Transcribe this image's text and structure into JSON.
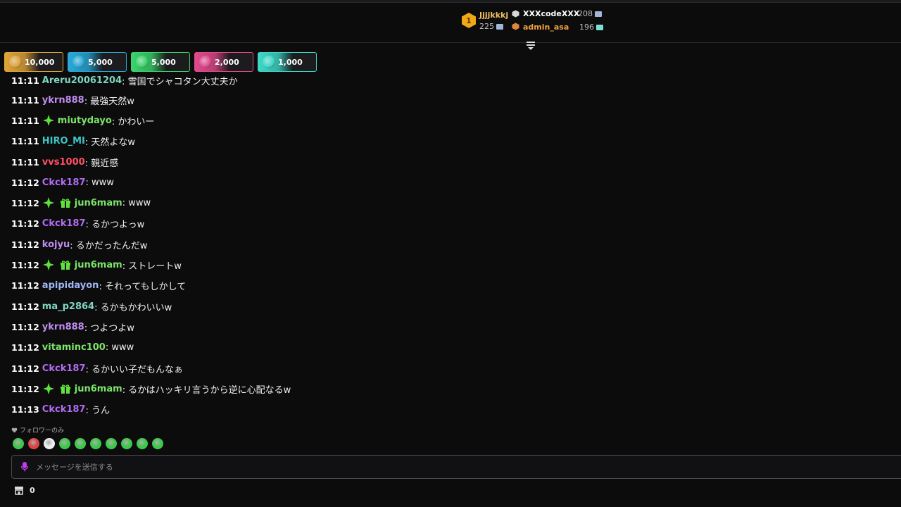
{
  "leaderboard": {
    "first": {
      "rank": "1",
      "name": "Jjjjkkkj",
      "points": "225"
    },
    "second": {
      "name": "XXXcodeXXX",
      "points": "208"
    },
    "third": {
      "name": "admin_asa",
      "points": "196"
    }
  },
  "tiers": [
    {
      "value": "10,000",
      "color": "#e0a43a"
    },
    {
      "value": "5,000",
      "color": "#2aa9d8"
    },
    {
      "value": "5,000",
      "color": "#3bd46b"
    },
    {
      "value": "2,000",
      "color": "#e04a8c"
    },
    {
      "value": "1,000",
      "color": "#3ed8c8"
    }
  ],
  "messages": [
    {
      "time": "11:11",
      "user": "Areru20061204",
      "text": ": 雪国でシャコタン大丈夫か",
      "color": "#7fd6c2"
    },
    {
      "time": "11:11",
      "user": "ykrn888",
      "text": ": 最強天然w",
      "color": "#c08cf0"
    },
    {
      "time": "11:11",
      "user": "miutydayo",
      "text": ": かわいー",
      "color": "#7de36a"
    },
    {
      "time": "11:11",
      "user": "HIRO_MI",
      "text": ": 天然よなw",
      "color": "#3fc4c4"
    },
    {
      "time": "11:11",
      "user": "vvs1000",
      "text": ": 親近感",
      "color": "#ff4f64"
    },
    {
      "time": "11:12",
      "user": "Ckck187",
      "text": ": www",
      "color": "#b06cf2"
    },
    {
      "time": "11:12",
      "user": "jun6mam",
      "text": ": www",
      "color": "#7de36a"
    },
    {
      "time": "11:12",
      "user": "Ckck187",
      "text": ": るかつよっw",
      "color": "#b06cf2"
    },
    {
      "time": "11:12",
      "user": "kojyu",
      "text": ": るかだったんだw",
      "color": "#c08cf0"
    },
    {
      "time": "11:12",
      "user": "jun6mam",
      "text": ": ストレートw",
      "color": "#7de36a"
    },
    {
      "time": "11:12",
      "user": "apipidayon",
      "text": ": それってもしかして",
      "color": "#9fb6f4"
    },
    {
      "time": "11:12",
      "user": "ma_p2864",
      "text": ": るかもかわいいw",
      "color": "#7fd6c2"
    },
    {
      "time": "11:12",
      "user": "ykrn888",
      "text": ": つよつよw",
      "color": "#c08cf0"
    },
    {
      "time": "11:12",
      "user": "vitaminc100",
      "text": ": www",
      "color": "#7de36a"
    },
    {
      "time": "11:12",
      "user": "Ckck187",
      "text": ": るかいい子だもんなぁ",
      "color": "#b06cf2"
    },
    {
      "time": "11:12",
      "user": "jun6mam",
      "text": ": るかはハッキリ言うから逆に心配なるw",
      "color": "#7de36a"
    },
    {
      "time": "11:13",
      "user": "Ckck187",
      "text": ": うん",
      "color": "#b06cf2"
    }
  ],
  "followers_only": "フォロワーのみ",
  "emotes": [
    "#3dc84a",
    "#d44",
    "#eee",
    "#3dc84a",
    "#3dc84a",
    "#3dc84a",
    "#3dc84a",
    "#3dc84a",
    "#3dc84a",
    "#3dc84a"
  ],
  "input": {
    "placeholder": "メッセージを送信する"
  },
  "store": {
    "count": "0"
  }
}
